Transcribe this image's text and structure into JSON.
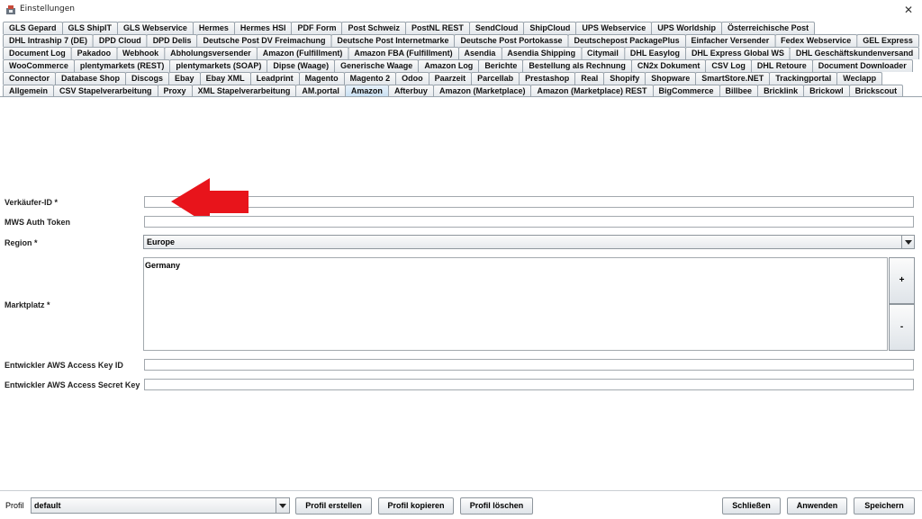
{
  "window": {
    "title": "Einstellungen",
    "close": "✕"
  },
  "tabs": {
    "row1": [
      "GLS Gepard",
      "GLS ShipIT",
      "GLS Webservice",
      "Hermes",
      "Hermes HSI",
      "PDF Form",
      "Post Schweiz",
      "PostNL REST",
      "SendCloud",
      "ShipCloud",
      "UPS Webservice",
      "UPS Worldship",
      "Österreichische Post"
    ],
    "row2": [
      "DHL Intraship 7 (DE)",
      "DPD Cloud",
      "DPD Delis",
      "Deutsche Post DV Freimachung",
      "Deutsche Post Internetmarke",
      "Deutsche Post Portokasse",
      "Deutschepost PackagePlus",
      "Einfacher Versender",
      "Fedex Webservice",
      "GEL Express"
    ],
    "row3": [
      "Document Log",
      "Pakadoo",
      "Webhook",
      "Abholungsversender",
      "Amazon (Fulfillment)",
      "Amazon FBA (Fulfillment)",
      "Asendia",
      "Asendia Shipping",
      "Citymail",
      "DHL Easylog",
      "DHL Express Global WS",
      "DHL Geschäftskundenversand"
    ],
    "row4": [
      "WooCommerce",
      "plentymarkets (REST)",
      "plentymarkets (SOAP)",
      "Dipse (Waage)",
      "Generische Waage",
      "Amazon Log",
      "Berichte",
      "Bestellung als Rechnung",
      "CN2x Dokument",
      "CSV Log",
      "DHL Retoure",
      "Document Downloader"
    ],
    "row5": [
      "Connector",
      "Database Shop",
      "Discogs",
      "Ebay",
      "Ebay XML",
      "Leadprint",
      "Magento",
      "Magento 2",
      "Odoo",
      "Paarzeit",
      "Parcellab",
      "Prestashop",
      "Real",
      "Shopify",
      "Shopware",
      "SmartStore.NET",
      "Trackingportal",
      "Weclapp"
    ],
    "row6": [
      "Allgemein",
      "CSV Stapelverarbeitung",
      "Proxy",
      "XML Stapelverarbeitung",
      "AM.portal",
      "Amazon",
      "Afterbuy",
      "Amazon (Marketplace)",
      "Amazon (Marketplace) REST",
      "BigCommerce",
      "Billbee",
      "Bricklink",
      "Brickowl",
      "Brickscout"
    ],
    "active": "Amazon"
  },
  "form": {
    "seller_id_label": "Verkäufer-ID *",
    "seller_id_value": "",
    "mws_token_label": "MWS Auth Token",
    "mws_token_value": "",
    "region_label": "Region *",
    "region_value": "Europe",
    "marketplace_label": "Marktplatz *",
    "marketplace_items": [
      "Germany"
    ],
    "add_label": "+",
    "remove_label": "-",
    "aws_key_id_label": "Entwickler AWS Access Key ID",
    "aws_key_id_value": "",
    "aws_secret_label": "Entwickler AWS Access Secret Key",
    "aws_secret_value": ""
  },
  "bottom": {
    "profil_label": "Profil",
    "profil_value": "default",
    "create_label": "Profil erstellen",
    "copy_label": "Profil kopieren",
    "delete_label": "Profil löschen",
    "close_label": "Schließen",
    "apply_label": "Anwenden",
    "save_label": "Speichern"
  },
  "colors": {
    "arrow": "#e8141b",
    "active_tab": "#c7dff2"
  }
}
